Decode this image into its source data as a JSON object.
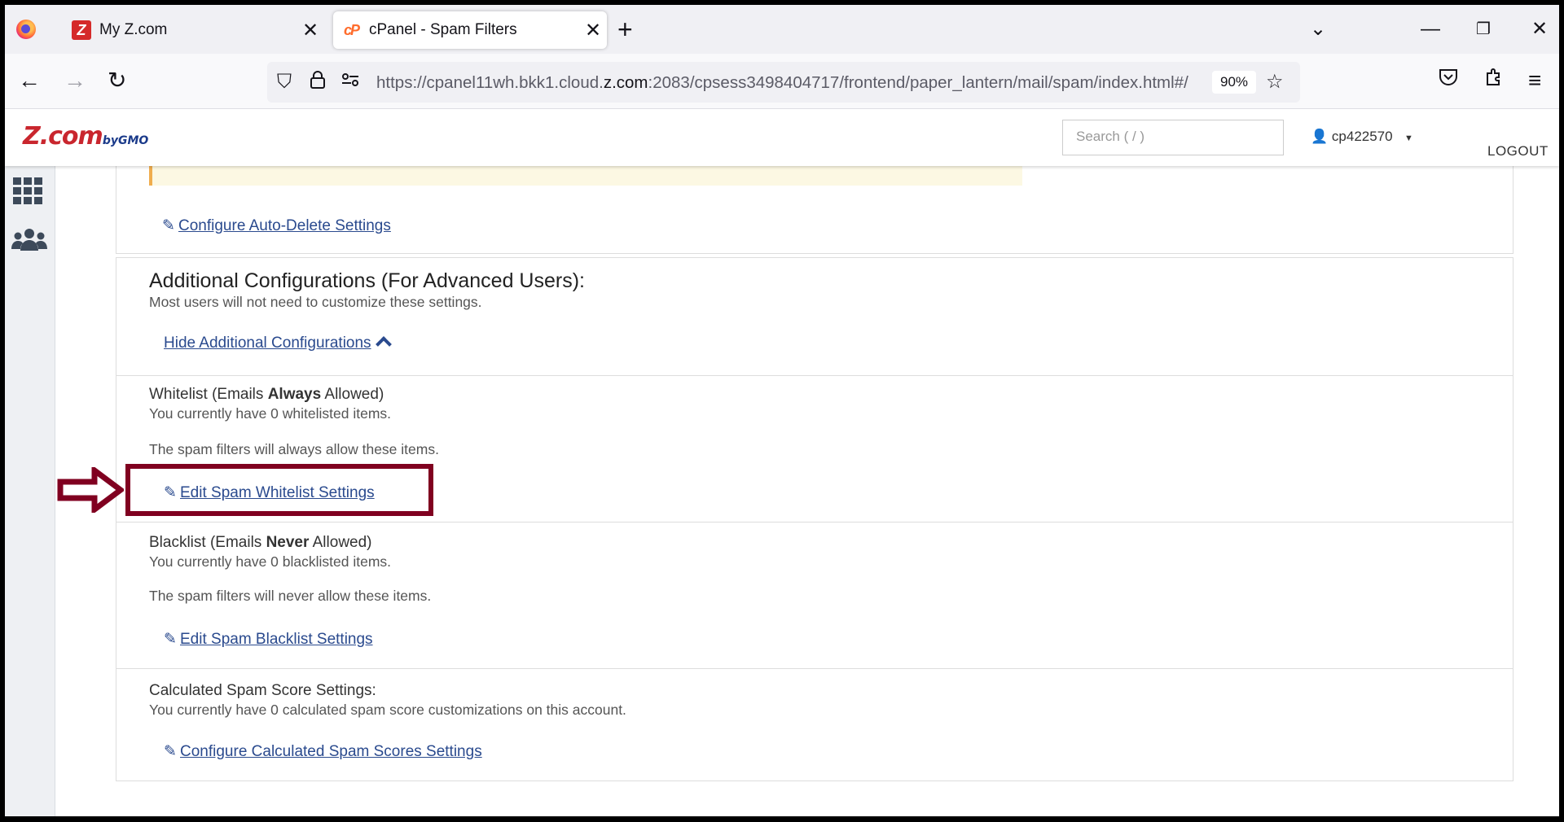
{
  "browser": {
    "tabs": [
      {
        "title": "My Z.com",
        "favicon": "z-logo-icon",
        "active": false
      },
      {
        "title": "cPanel - Spam Filters",
        "favicon": "cpanel-logo-icon",
        "active": true
      }
    ],
    "url_prefix": "https://cpanel11wh.bkk1.cloud.",
    "url_domain": "z.com",
    "url_suffix": ":2083/cpsess3498404717/frontend/paper_lantern/mail/spam/index.html#/",
    "zoom": "90%"
  },
  "header": {
    "brand": "Z.com",
    "brand_sub": "byGMO",
    "search_placeholder": "Search ( / )",
    "username": "cp422570",
    "logout": "LOGOUT"
  },
  "auto_delete": {
    "link": "Configure Auto-Delete Settings"
  },
  "additional": {
    "title": "Additional Configurations (For Advanced Users):",
    "subtitle": "Most users will not need to customize these settings.",
    "hide_link": "Hide Additional Configurations"
  },
  "whitelist": {
    "title_pre": "Whitelist (Emails ",
    "title_bold": "Always",
    "title_post": " Allowed)",
    "count_text": "You currently have 0 whitelisted items.",
    "desc": "The spam filters will always allow these items.",
    "link": "Edit Spam Whitelist Settings"
  },
  "blacklist": {
    "title_pre": "Blacklist (Emails ",
    "title_bold": "Never",
    "title_post": " Allowed)",
    "count_text": "You currently have 0 blacklisted items.",
    "desc": "The spam filters will never allow these items.",
    "link": "Edit Spam Blacklist Settings"
  },
  "spam_score": {
    "title": "Calculated Spam Score Settings:",
    "count_text": "You currently have 0 calculated spam score customizations on this account.",
    "link": "Configure Calculated Spam Scores Settings"
  },
  "colors": {
    "link": "#2a4a8e",
    "annotation": "#800020",
    "brand": "#c9262e"
  }
}
